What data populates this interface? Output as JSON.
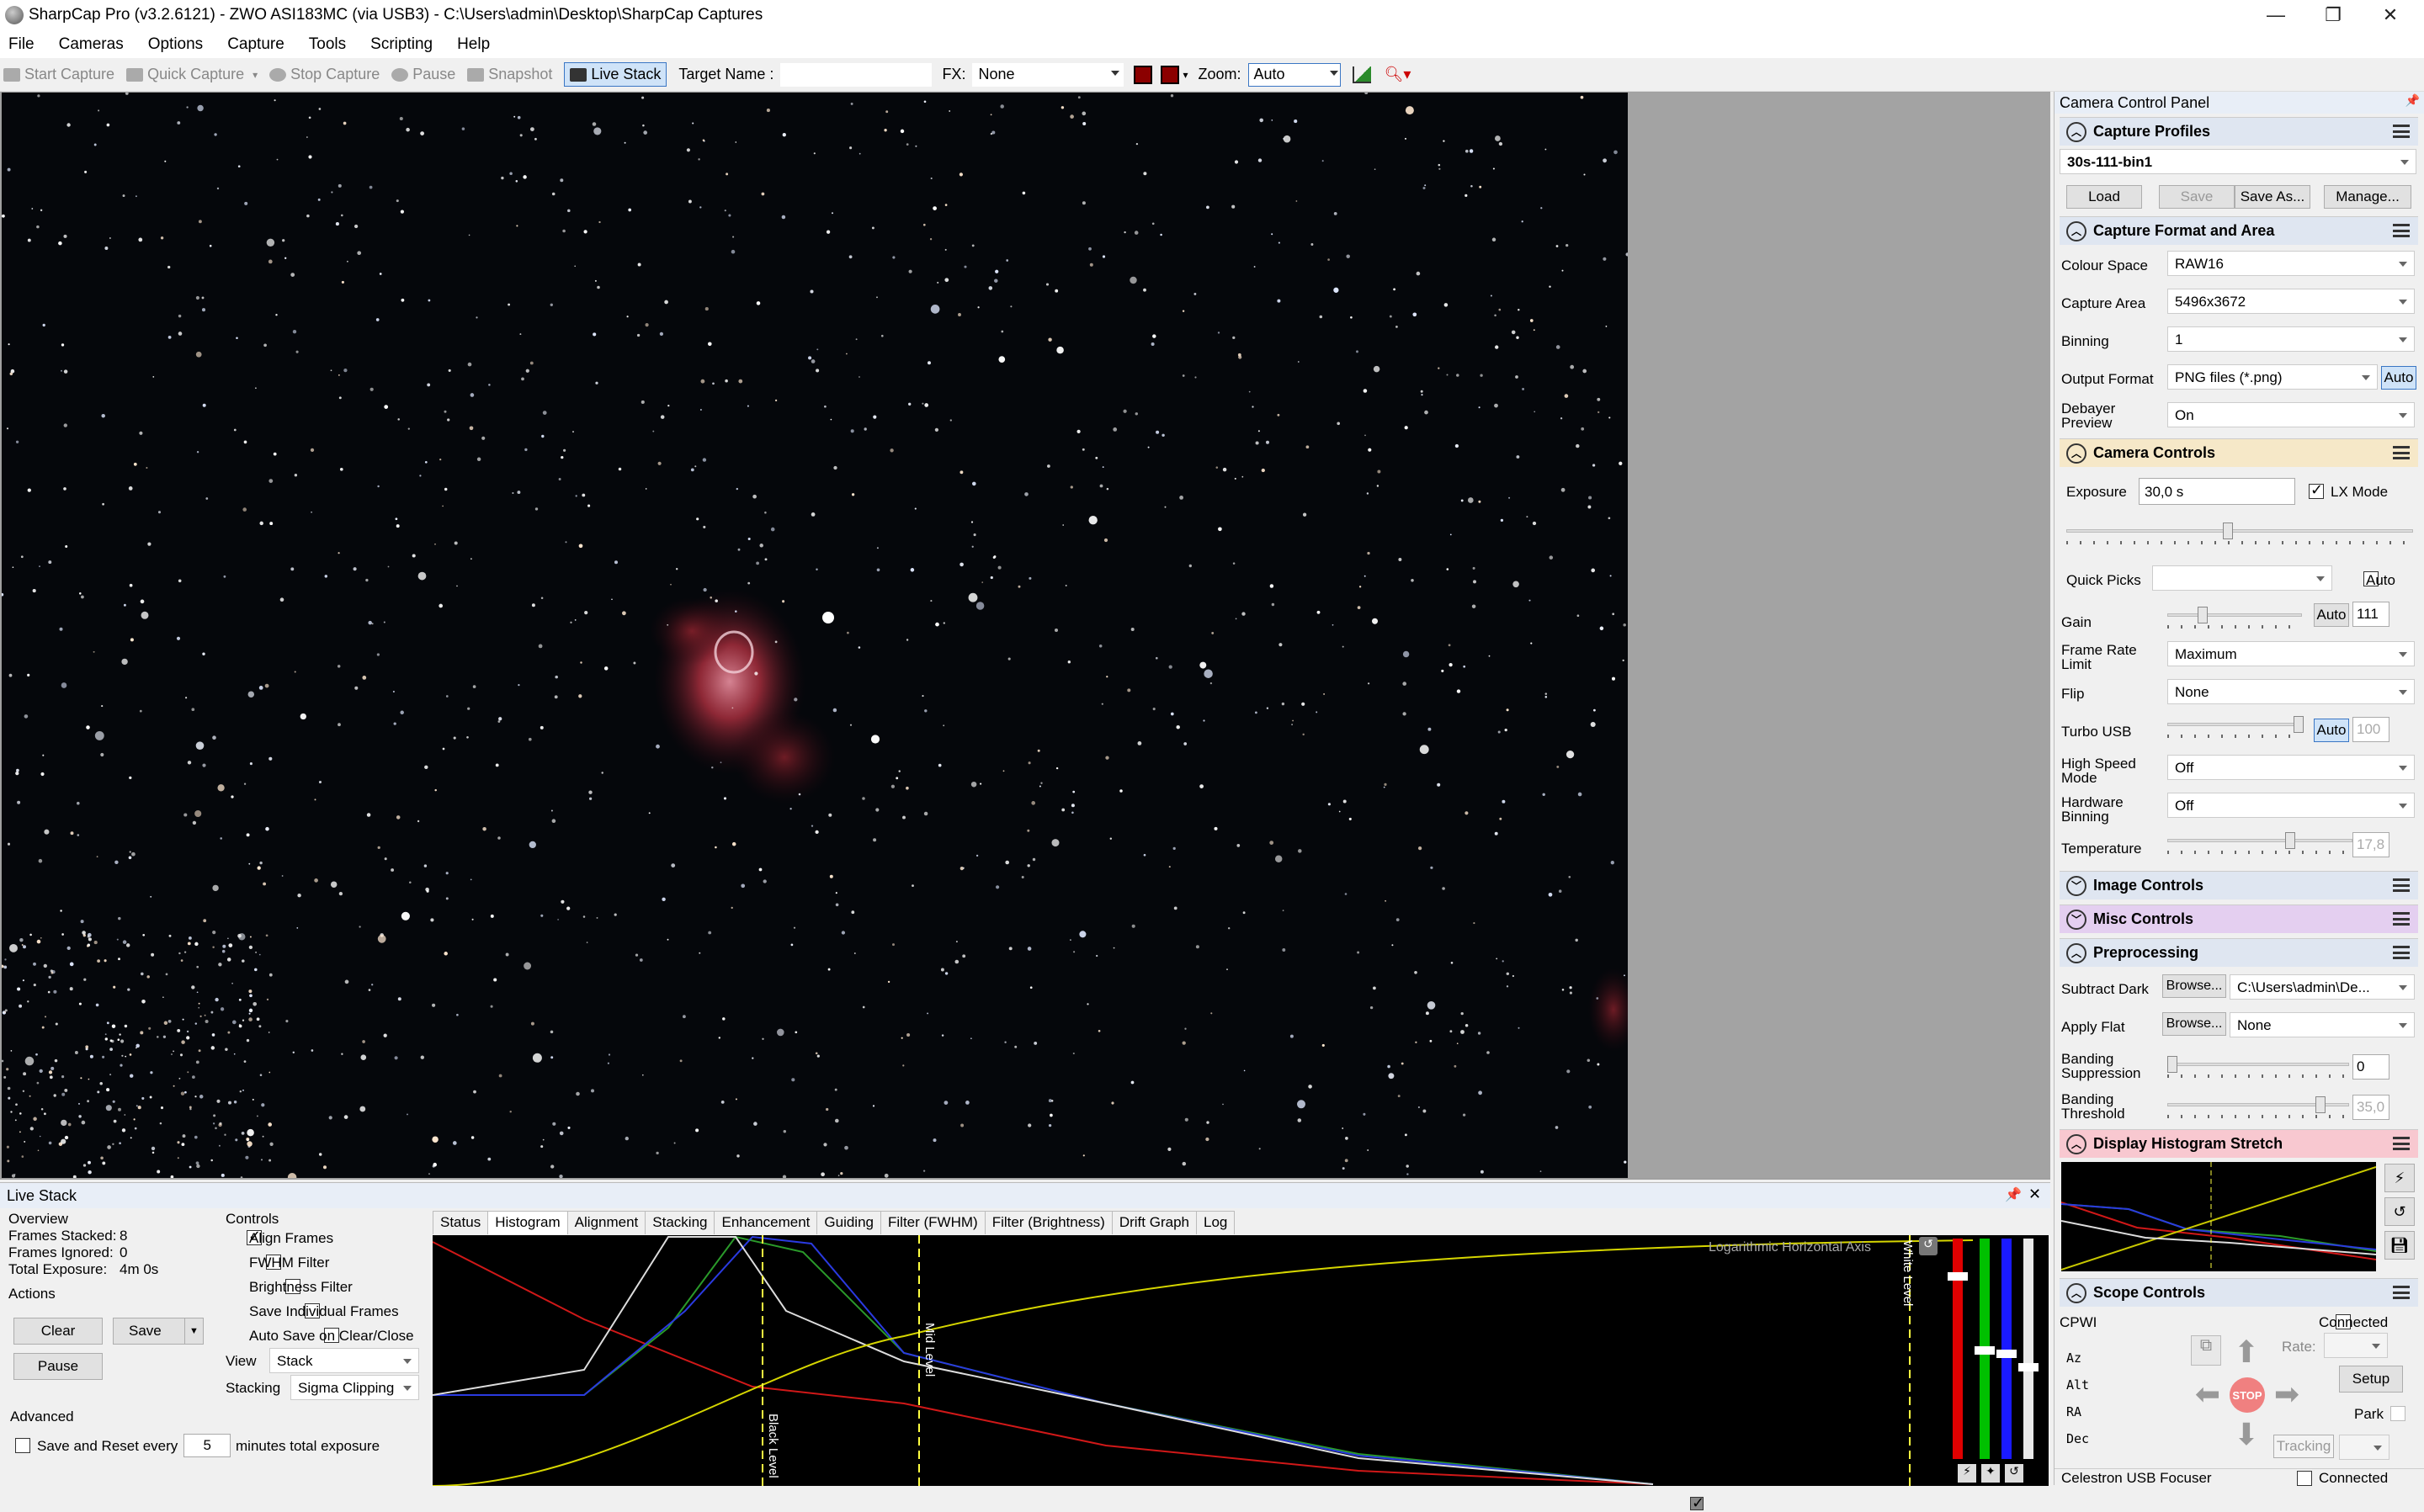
{
  "window": {
    "title": "SharpCap Pro (v3.2.6121) - ZWO ASI183MC (via USB3) - C:\\Users\\admin\\Desktop\\SharpCap Captures",
    "minimize": "—",
    "maximize": "❐",
    "close": "✕"
  },
  "menu": [
    "File",
    "Cameras",
    "Options",
    "Capture",
    "Tools",
    "Scripting",
    "Help"
  ],
  "toolbar": {
    "start_capture": "Start Capture",
    "quick_capture": "Quick Capture",
    "stop_capture": "Stop Capture",
    "pause": "Pause",
    "snapshot": "Snapshot",
    "live_stack": "Live Stack",
    "target_name_label": "Target Name :",
    "target_name_value": "",
    "fx_label": "FX:",
    "fx_value": "None",
    "zoom_label": "Zoom:",
    "zoom_value": "Auto"
  },
  "live_stack": {
    "title": "Live Stack",
    "pin": "📌",
    "close": "✕",
    "overview": {
      "heading": "Overview",
      "frames_stacked_label": "Frames Stacked:",
      "frames_stacked": "8",
      "frames_ignored_label": "Frames Ignored:",
      "frames_ignored": "0",
      "total_exposure_label": "Total Exposure:",
      "total_exposure": "4m 0s"
    },
    "actions": {
      "heading": "Actions",
      "clear": "Clear",
      "save": "Save",
      "pause": "Pause"
    },
    "advanced": {
      "heading": "Advanced",
      "save_reset_label": "Save and Reset every",
      "minutes_value": "5",
      "minutes_suffix": "minutes total exposure"
    },
    "controls": {
      "heading": "Controls",
      "align_frames": "Align Frames",
      "fwhm_filter": "FWHM Filter",
      "brightness_filter": "Brightness Filter",
      "save_individual": "Save Individual Frames",
      "auto_save": "Auto Save on Clear/Close",
      "view_label": "View",
      "view_value": "Stack",
      "stacking_label": "Stacking",
      "stacking_value": "Sigma Clipping"
    },
    "tabs": [
      "Status",
      "Histogram",
      "Alignment",
      "Stacking",
      "Enhancement",
      "Guiding",
      "Filter (FWHM)",
      "Filter (Brightness)",
      "Drift Graph",
      "Log"
    ],
    "histogram": {
      "log_axis_label": "Logarithmic Horizontal Axis",
      "black_level": "Black Level",
      "mid_level": "Mid Level",
      "white_level": "White Level"
    }
  },
  "camera_panel": {
    "title": "Camera Control Panel",
    "capture_profiles": {
      "heading": "Capture Profiles",
      "profile": "30s-111-bin1",
      "load": "Load",
      "save": "Save",
      "save_as": "Save As...",
      "manage": "Manage..."
    },
    "capture_format": {
      "heading": "Capture Format and Area",
      "colour_space_label": "Colour Space",
      "colour_space": "RAW16",
      "capture_area_label": "Capture Area",
      "capture_area": "5496x3672",
      "binning_label": "Binning",
      "binning": "1",
      "output_format_label": "Output Format",
      "output_format": "PNG files (*.png)",
      "auto": "Auto",
      "debayer_label": "Debayer Preview",
      "debayer": "On"
    },
    "camera_controls": {
      "heading": "Camera Controls",
      "exposure_label": "Exposure",
      "exposure": "30,0 s",
      "lx_mode": "LX Mode",
      "quick_picks_label": "Quick Picks",
      "quick_picks_auto": "Auto",
      "gain_label": "Gain",
      "gain_auto": "Auto",
      "gain": "111",
      "frame_rate_label": "Frame Rate Limit",
      "frame_rate": "Maximum",
      "flip_label": "Flip",
      "flip": "None",
      "turbo_usb_label": "Turbo USB",
      "turbo_auto": "Auto",
      "turbo_value": "100",
      "high_speed_label": "High Speed Mode",
      "high_speed": "Off",
      "hw_binning_label": "Hardware Binning",
      "hw_binning": "Off",
      "temperature_label": "Temperature",
      "temperature": "17,8"
    },
    "image_controls": {
      "heading": "Image Controls"
    },
    "misc_controls": {
      "heading": "Misc Controls"
    },
    "preprocessing": {
      "heading": "Preprocessing",
      "subtract_dark_label": "Subtract Dark",
      "browse": "Browse...",
      "subtract_dark": "C:\\Users\\admin\\De...",
      "apply_flat_label": "Apply Flat",
      "apply_flat": "None",
      "banding_supp_label": "Banding Suppression",
      "banding_supp": "0",
      "banding_thresh_label": "Banding Threshold",
      "banding_thresh": "35,0"
    },
    "display_histogram": {
      "heading": "Display Histogram Stretch"
    },
    "scope_controls": {
      "heading": "Scope Controls",
      "device": "CPWI",
      "connected": "Connected",
      "rate_label": "Rate:",
      "setup": "Setup",
      "park": "Park",
      "az": "Az",
      "alt": "Alt",
      "ra": "RA",
      "dec": "Dec",
      "stop": "STOP",
      "tracking": "Tracking"
    },
    "focuser": {
      "device": "Celestron USB Focuser",
      "connected": "Connected"
    }
  },
  "colors": {
    "accent": "#3a76c4",
    "red_head": "#f8c8d0",
    "purple_head": "#e4cff0"
  }
}
